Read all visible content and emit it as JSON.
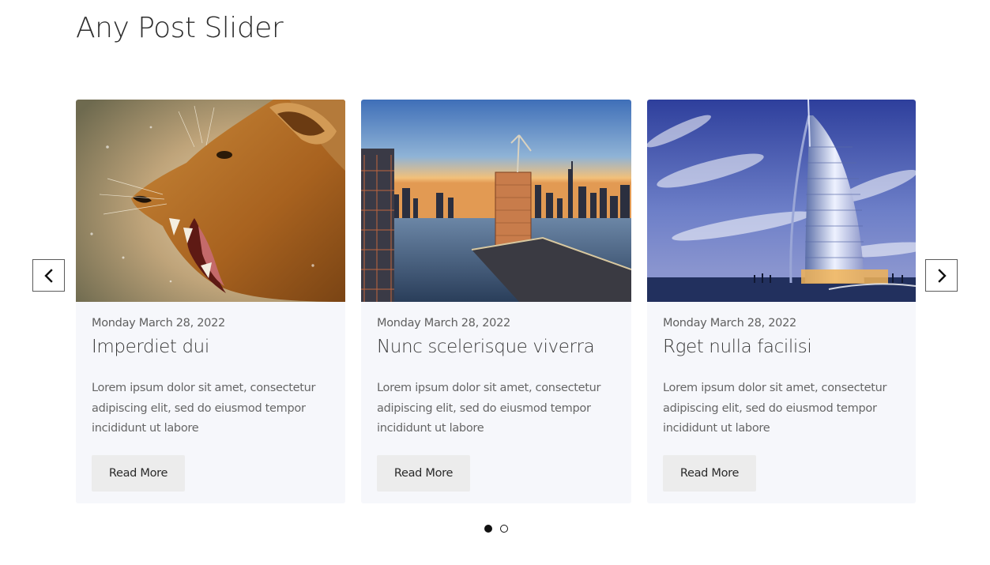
{
  "page": {
    "title": "Any Post Slider"
  },
  "slider": {
    "prev_icon": "chevron-left-icon",
    "next_icon": "chevron-right-icon",
    "posts": [
      {
        "date": "Monday March 28, 2022",
        "title": "Imperdiet dui",
        "excerpt": "Lorem ipsum dolor sit amet, consectetur adipiscing elit, sed do eiusmod tempor incididunt ut labore",
        "button": "Read More",
        "image": "lioness-roaring"
      },
      {
        "date": "Monday March 28, 2022",
        "title": "Nunc scelerisque viverra",
        "excerpt": "Lorem ipsum dolor sit amet, consectetur adipiscing elit, sed do eiusmod tempor incididunt ut labore",
        "button": "Read More",
        "image": "city-skyline-sunset"
      },
      {
        "date": "Monday March 28, 2022",
        "title": "Rget nulla facilisi",
        "excerpt": "Lorem ipsum dolor sit amet, consectetur adipiscing elit, sed do eiusmod tempor incididunt ut labore",
        "button": "Read More",
        "image": "sail-shaped-hotel-tower"
      }
    ],
    "pagination": {
      "pages": 2,
      "active": 1
    }
  }
}
